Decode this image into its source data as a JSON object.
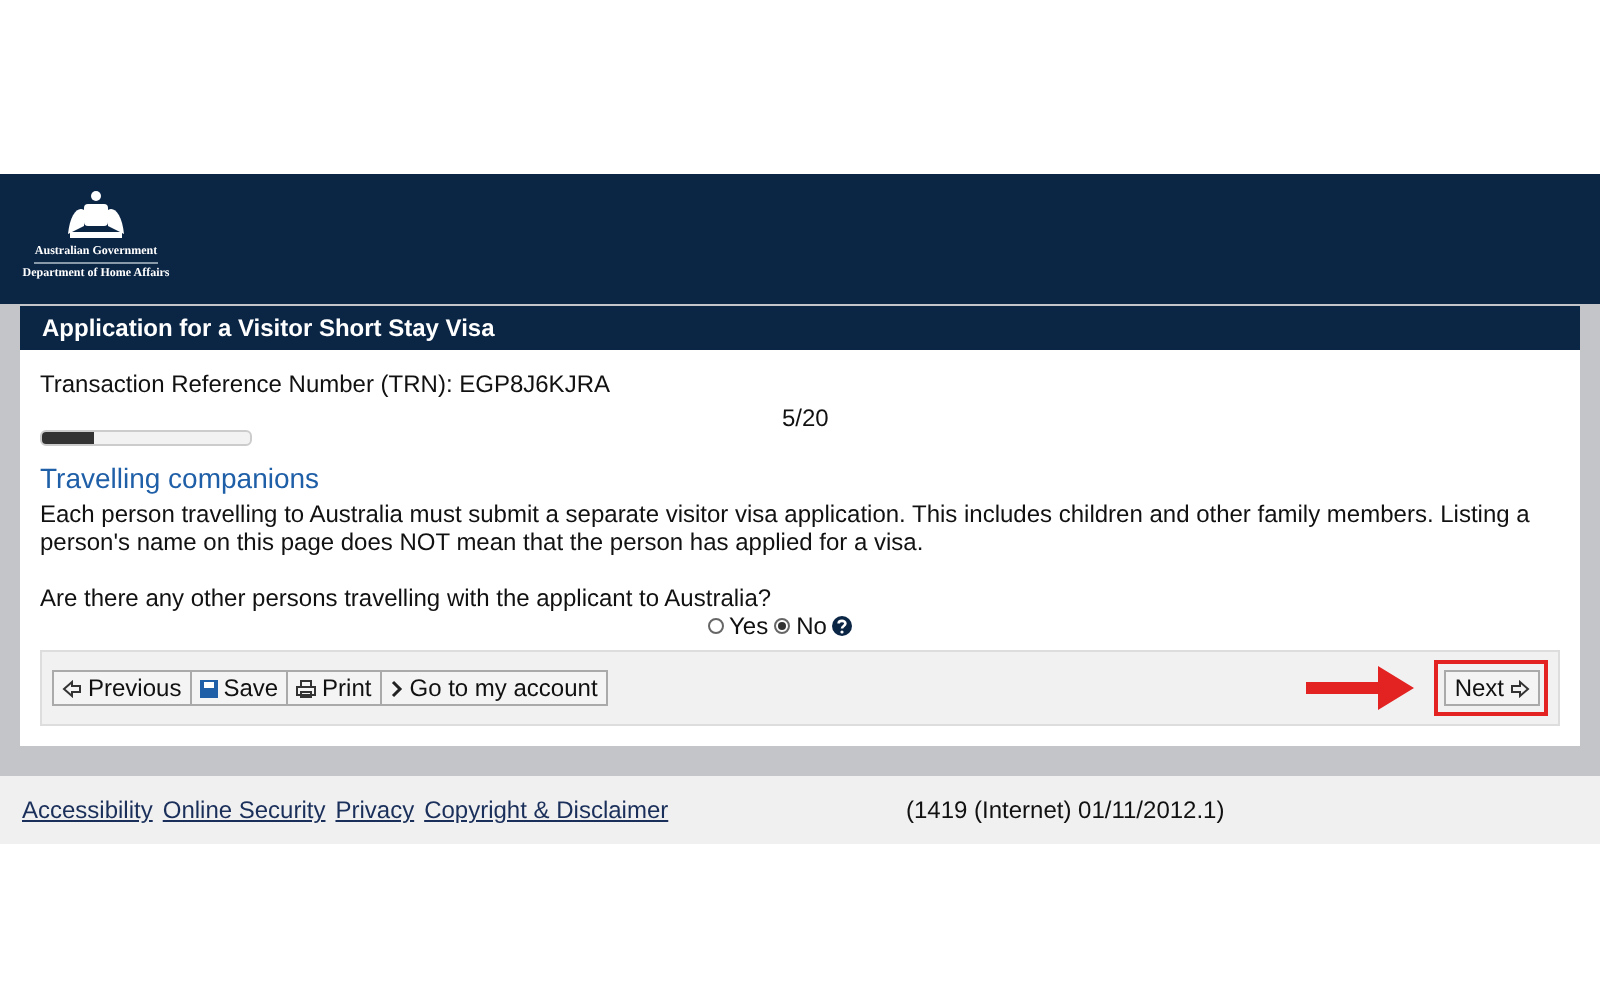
{
  "header": {
    "agency_lines": [
      "Australian Government",
      "Department of Home Affairs"
    ]
  },
  "form": {
    "title": "Application for a Visitor Short Stay Visa",
    "trn": "Transaction Reference Number (TRN): EGP8J6KJRA",
    "progress": {
      "level": 0.25,
      "reading": "5/20"
    },
    "section_title": "Travelling companions",
    "intro": "Each person travelling to Australia must submit a separate visitor visa application. This includes children and other family members. Listing a person's name on this page does NOT mean that the person has applied for a visa.",
    "question": "Are there any other persons travelling with the applicant to Australia?",
    "options": [
      {
        "label": "Yes",
        "selected": false
      },
      {
        "label": "No",
        "selected": true
      }
    ],
    "buttons": [
      {
        "kind": "previous",
        "label": "Previous"
      },
      {
        "kind": "save",
        "label": "Save"
      },
      {
        "kind": "print",
        "label": "Print"
      },
      {
        "kind": "account",
        "label": "Go to my account"
      }
    ],
    "next_button": {
      "label": "Next",
      "highlighted": true
    }
  },
  "footer": {
    "links": [
      "Accessibility",
      "Online Security",
      "Privacy",
      "Copyright & Disclaimer"
    ],
    "version": "(1419 (Internet) 01/11/2012.1)"
  }
}
